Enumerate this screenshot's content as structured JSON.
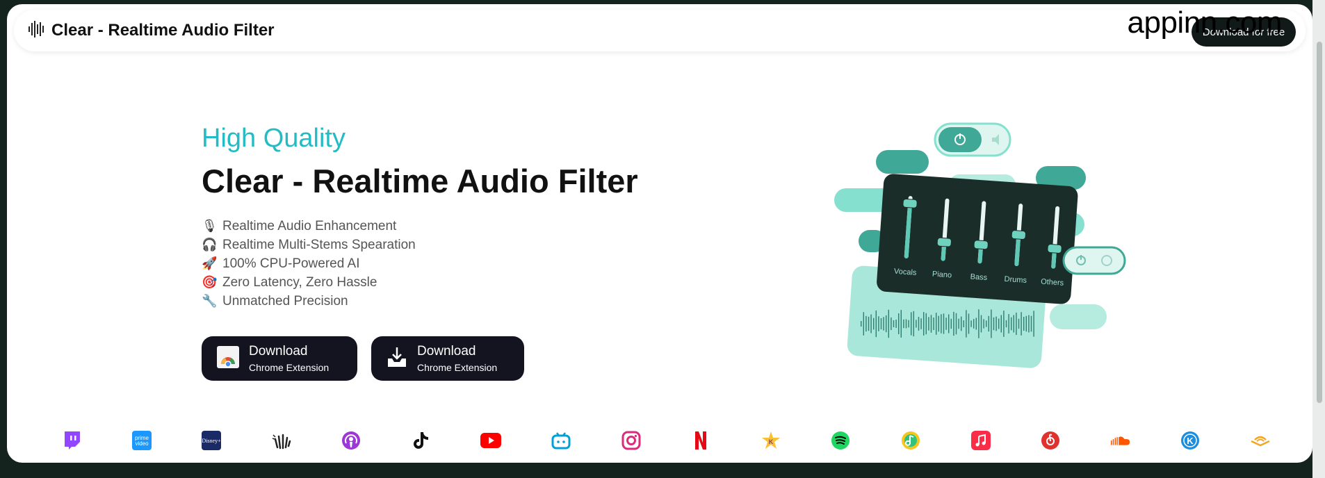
{
  "navbar": {
    "title": "Clear - Realtime Audio Filter",
    "download_label": "Download for free",
    "watermark": "appinn.com"
  },
  "hero": {
    "subtitle": "High Quality",
    "title": "Clear - Realtime Audio Filter",
    "features": [
      {
        "icon": "microphone-icon",
        "glyph": "🎙",
        "label": "Realtime Audio Enhancement"
      },
      {
        "icon": "headphones-icon",
        "glyph": "🎧",
        "label": "Realtime Multi-Stems Spearation"
      },
      {
        "icon": "rocket-icon",
        "glyph": "🚀",
        "label": "100% CPU-Powered AI"
      },
      {
        "icon": "target-icon",
        "glyph": "🎯",
        "label": "Zero Latency, Zero Hassle"
      },
      {
        "icon": "wrench-icon",
        "glyph": "🔧",
        "label": "Unmatched Precision"
      }
    ],
    "buttons": [
      {
        "main": "Download",
        "sub": "Chrome Extension",
        "icon": "chrome-logo-icon"
      },
      {
        "main": "Download",
        "sub": "Chrome Extension",
        "icon": "download-tray-icon"
      }
    ]
  },
  "illustration": {
    "sliders": [
      "Vocals",
      "Piano",
      "Bass",
      "Drums",
      "Others"
    ],
    "slider_levels": [
      0.88,
      0.3,
      0.3,
      0.5,
      0.32
    ]
  },
  "platforms": [
    "twitch",
    "prime-video",
    "disney-plus",
    "hand-wave",
    "podcasts",
    "tiktok",
    "youtube",
    "bilibili",
    "instagram",
    "netflix",
    "kmusic",
    "spotify",
    "qq-music",
    "apple-music",
    "netease-music",
    "soundcloud",
    "kugou",
    "audible"
  ],
  "colors": {
    "accent": "#23bcc4",
    "teal": "#3fa896",
    "mint": "#86e0cf",
    "dark_panel": "#1b2d29",
    "button_bg": "#131420"
  }
}
